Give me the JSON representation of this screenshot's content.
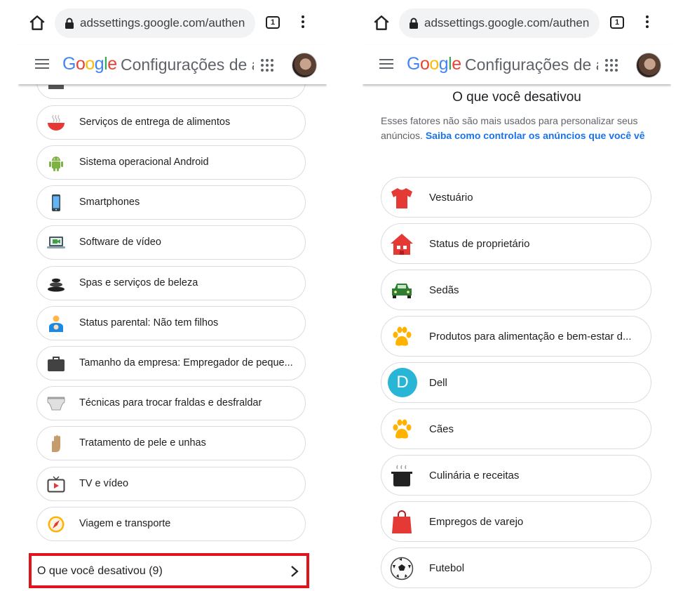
{
  "browser": {
    "url": "adssettings.google.com/authen",
    "tab_count": "1"
  },
  "header": {
    "logo": [
      "G",
      "o",
      "o",
      "g",
      "l",
      "e"
    ],
    "title": "Configurações de anúncios"
  },
  "left_list": {
    "items": [
      {
        "label": "",
        "icon": "partial-icon"
      },
      {
        "label": "Serviços de entrega de alimentos",
        "icon": "food-bowl-icon"
      },
      {
        "label": "Sistema operacional Android",
        "icon": "android-icon"
      },
      {
        "label": "Smartphones",
        "icon": "smartphone-icon"
      },
      {
        "label": "Software de vídeo",
        "icon": "video-laptop-icon"
      },
      {
        "label": "Spas e serviços de beleza",
        "icon": "spa-stones-icon"
      },
      {
        "label": "Status parental: Não tem filhos",
        "icon": "parent-icon"
      },
      {
        "label": "Tamanho da empresa: Empregador de peque...",
        "icon": "briefcase-icon"
      },
      {
        "label": "Técnicas para trocar fraldas e desfraldar",
        "icon": "diaper-icon"
      },
      {
        "label": "Tratamento de pele e unhas",
        "icon": "hand-icon"
      },
      {
        "label": "TV e vídeo",
        "icon": "tv-icon"
      },
      {
        "label": "Viagem e transporte",
        "icon": "compass-icon"
      }
    ],
    "disabled_link": "O que você desativou (9)"
  },
  "right_panel": {
    "heading": "O que você desativou",
    "description": "Esses fatores não são mais usados para personalizar seus anúncios.",
    "link": "Saiba como controlar os anúncios que você vê",
    "items": [
      {
        "label": "Vestuário",
        "icon": "shirt-icon"
      },
      {
        "label": "Status de proprietário",
        "icon": "house-icon"
      },
      {
        "label": "Sedãs",
        "icon": "car-icon"
      },
      {
        "label": "Produtos para alimentação e bem-estar d...",
        "icon": "paw-icon"
      },
      {
        "label": "Dell",
        "icon": "dell-letter-icon",
        "letter": "D"
      },
      {
        "label": "Cães",
        "icon": "paw-icon"
      },
      {
        "label": "Culinária e receitas",
        "icon": "cooking-pot-icon"
      },
      {
        "label": "Empregos de varejo",
        "icon": "shopping-bag-icon"
      },
      {
        "label": "Futebol",
        "icon": "soccer-ball-icon"
      }
    ]
  },
  "colors": {
    "google_blue": "#4285F4",
    "google_red": "#EA4335",
    "google_yellow": "#FBBC05",
    "google_green": "#34A853",
    "highlight": "#e0141c",
    "link": "#1a73e8"
  }
}
